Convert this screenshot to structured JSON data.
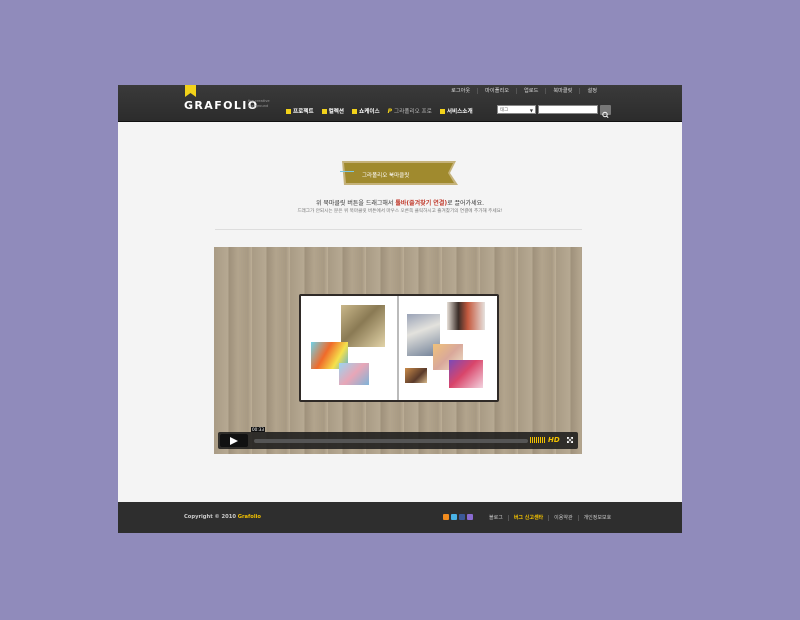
{
  "colors": {
    "page_bg": "#908bbb",
    "header_bg": "#2c2c2c",
    "accent_yellow": "#f2d21a",
    "banner_gold": "#a08a2e",
    "highlight_red": "#c0392b"
  },
  "header": {
    "logo": "GRAFOLIO",
    "tagline": "the creative playground",
    "top_nav": [
      "로그아웃",
      "마이폴리오",
      "업로드",
      "북마클릿",
      "설정"
    ],
    "main_nav": [
      {
        "label": "프로젝트",
        "icon": "grid-icon"
      },
      {
        "label": "컬렉션",
        "icon": "collection-icon"
      },
      {
        "label": "쇼케이스",
        "icon": "showcase-icon"
      },
      {
        "label": "그라폴리오 프로",
        "icon": "p-icon"
      },
      {
        "label": "서비스소개",
        "icon": "chat-icon"
      }
    ],
    "search": {
      "select_value": "태그",
      "placeholder": ""
    }
  },
  "content": {
    "title": "그라폴리오 북마클릿",
    "desc_pre": "위 북마클릿 버튼을 드래그해서 ",
    "desc_highlight": "툴바(즐겨찾기 연결)",
    "desc_post": "로 끌어가세요.",
    "desc_sub": "드래그가 안되시는 분은 위 북마클릿 버튼에서 마우스 오른쪽 클릭하시고 즐겨찾기의 연결에 추가해 주세요!"
  },
  "video": {
    "timecode": "00:33",
    "progress": 0.0,
    "hd_label": "HD"
  },
  "footer": {
    "copyright_prefix": "Copyright © 2010 ",
    "copyright_brand": "Grafolio",
    "social_icons": [
      "rss-icon",
      "me2day-icon",
      "facebook-icon",
      "yozm-icon"
    ],
    "links": [
      {
        "label": "블로그",
        "highlight": false
      },
      {
        "label": "버그 신고센타",
        "highlight": true
      },
      {
        "label": "이용약관",
        "highlight": false
      },
      {
        "label": "개인정보보호",
        "highlight": false
      }
    ]
  }
}
